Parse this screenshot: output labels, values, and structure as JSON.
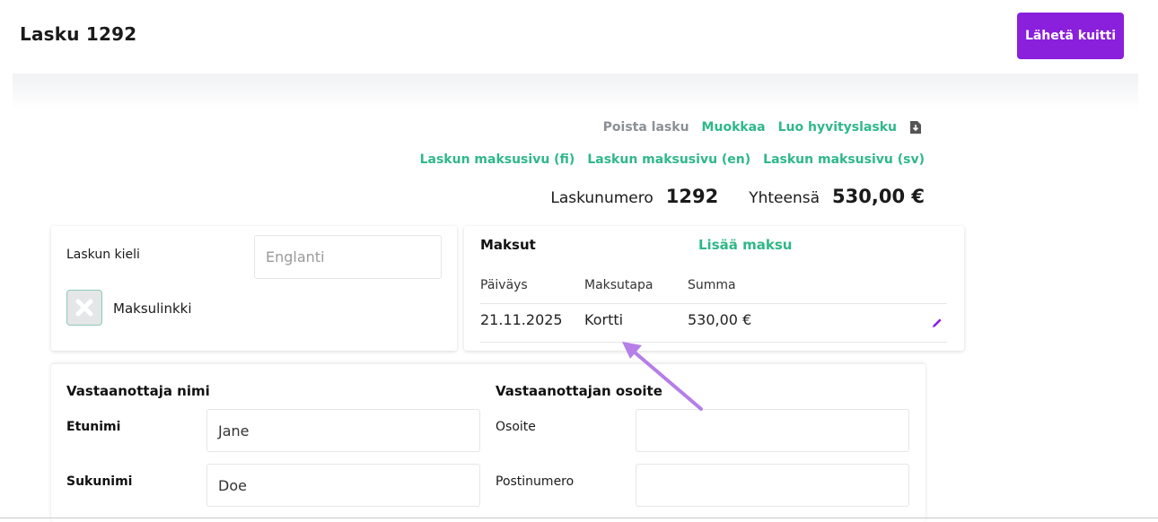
{
  "header": {
    "title": "Lasku 1292",
    "send_receipt_label": "Lähetä kuitti"
  },
  "actions": {
    "delete_label": "Poista lasku",
    "edit_label": "Muokkaa",
    "credit_label": "Luo hyvityslasku",
    "credit_icon": "document-download-icon"
  },
  "payment_pages": [
    "Laskun maksusivu (fi)",
    "Laskun maksusivu (en)",
    "Laskun maksusivu (sv)"
  ],
  "totals": {
    "invoice_number_label": "Laskunumero",
    "invoice_number": "1292",
    "total_label": "Yhteensä",
    "total": "530,00 €"
  },
  "settings": {
    "language_label": "Laskun kieli",
    "language_placeholder": "Englanti",
    "payment_link_label": "Maksulinkki",
    "payment_link_checked": false
  },
  "payments": {
    "title": "Maksut",
    "add_label": "Lisää maksu",
    "columns": [
      "Päiväys",
      "Maksutapa",
      "Summa"
    ],
    "rows": [
      {
        "date": "21.11.2025",
        "method": "Kortti",
        "amount": "530,00 €"
      }
    ],
    "edit_icon": "pencil-icon"
  },
  "recipient": {
    "name_title": "Vastaanottaja nimi",
    "first_name_label": "Etunimi",
    "first_name": "Jane",
    "last_name_label": "Sukunimi",
    "last_name": "Doe",
    "address_title": "Vastaanottajan osoite",
    "address_label": "Osoite",
    "address": "",
    "postal_label": "Postinumero",
    "postal": ""
  },
  "colors": {
    "accent": "#8a1fdc",
    "link": "#2fb888",
    "annotation_arrow": "#b57ee8"
  }
}
